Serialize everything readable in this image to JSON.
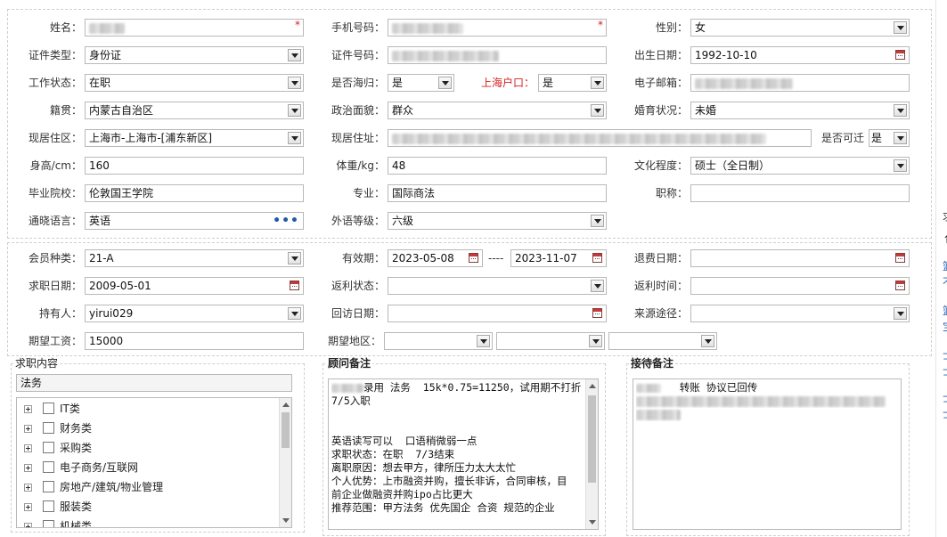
{
  "personal": {
    "name": {
      "label": "姓名："
    },
    "phone": {
      "label": "手机号码："
    },
    "gender": {
      "label": "性别：",
      "value": "女"
    },
    "id_type": {
      "label": "证件类型：",
      "value": "身份证"
    },
    "id_number": {
      "label": "证件号码："
    },
    "birth_date": {
      "label": "出生日期：",
      "value": "1992-10-10"
    },
    "work_status": {
      "label": "工作状态：",
      "value": "在职"
    },
    "returnee": {
      "label": "是否海归：",
      "value": "是"
    },
    "shanghai_hukou": {
      "label": "上海户口：",
      "value": "是"
    },
    "email": {
      "label": "电子邮箱："
    },
    "native_place": {
      "label": "籍贯：",
      "value": "内蒙古自治区"
    },
    "political": {
      "label": "政治面貌：",
      "value": "群众"
    },
    "marital": {
      "label": "婚育状况：",
      "value": "未婚"
    },
    "residence_area": {
      "label": "现居住区：",
      "value": "上海市-上海市-[浦东新区]"
    },
    "residence_address": {
      "label": "现居住址："
    },
    "relocate": {
      "label": "是否可迁",
      "value": "是"
    },
    "height": {
      "label": "身高/cm：",
      "value": "160"
    },
    "weight": {
      "label": "体重/kg：",
      "value": "48"
    },
    "education": {
      "label": "文化程度：",
      "value": "硕士（全日制）"
    },
    "school": {
      "label": "毕业院校：",
      "value": "伦敦国王学院"
    },
    "major": {
      "label": "专业：",
      "value": "国际商法"
    },
    "title": {
      "label": "职称：",
      "value": ""
    },
    "language": {
      "label": "通晓语言：",
      "value": "英语"
    },
    "lang_level": {
      "label": "外语等级：",
      "value": "六级"
    }
  },
  "membership": {
    "member_type": {
      "label": "会员种类：",
      "value": "21-A"
    },
    "valid_period": {
      "label": "有效期：",
      "from": "2023-05-08",
      "sep": "----",
      "to": "2023-11-07"
    },
    "refund_date": {
      "label": "退费日期：",
      "value": ""
    },
    "job_date": {
      "label": "求职日期：",
      "value": "2009-05-01"
    },
    "rebate_status": {
      "label": "返利状态：",
      "value": ""
    },
    "rebate_time": {
      "label": "返利时间：",
      "value": ""
    },
    "holder": {
      "label": "持有人：",
      "value": "yirui029"
    },
    "visit_date": {
      "label": "回访日期：",
      "value": ""
    },
    "source": {
      "label": "来源途径：",
      "value": ""
    },
    "salary": {
      "label": "期望工资：",
      "value": "15000"
    },
    "region": {
      "label": "期望地区：",
      "values": [
        "",
        "",
        ""
      ]
    }
  },
  "job_content": {
    "title": "求职内容",
    "search_value": "法务",
    "tree": [
      "IT类",
      "财务类",
      "采购类",
      "电子商务/互联网",
      "房地产/建筑/物业管理",
      "服装类",
      "机械类"
    ]
  },
  "consultant_note": {
    "title": "顾问备注",
    "lines": [
      "录用 法务  15k*0.75=11250，试用期不打折",
      "7/5入职",
      "",
      "",
      "英语读写可以  口语稍微弱一点",
      "求职状态：在职  7/3结束",
      "离职原因：想去甲方，律所压力太大太忙",
      "个人优势：上市融资并购，擅长非诉，合同审核，目",
      "前企业做融资并购ipo占比更大",
      "推荐范围：甲方法务 优先国企 合资 规范的企业"
    ]
  },
  "reception_note": {
    "title": "接待备注",
    "line1": "转账 协议已回传"
  },
  "right_edge": {
    "chars": [
      "求",
      "↑",
      "篮",
      "不",
      "篮",
      "宝",
      "士",
      "士",
      "士",
      "士"
    ]
  },
  "colors": {
    "required": "#d62020",
    "link": "#1e5aa8",
    "border": "#b9b9b9"
  }
}
